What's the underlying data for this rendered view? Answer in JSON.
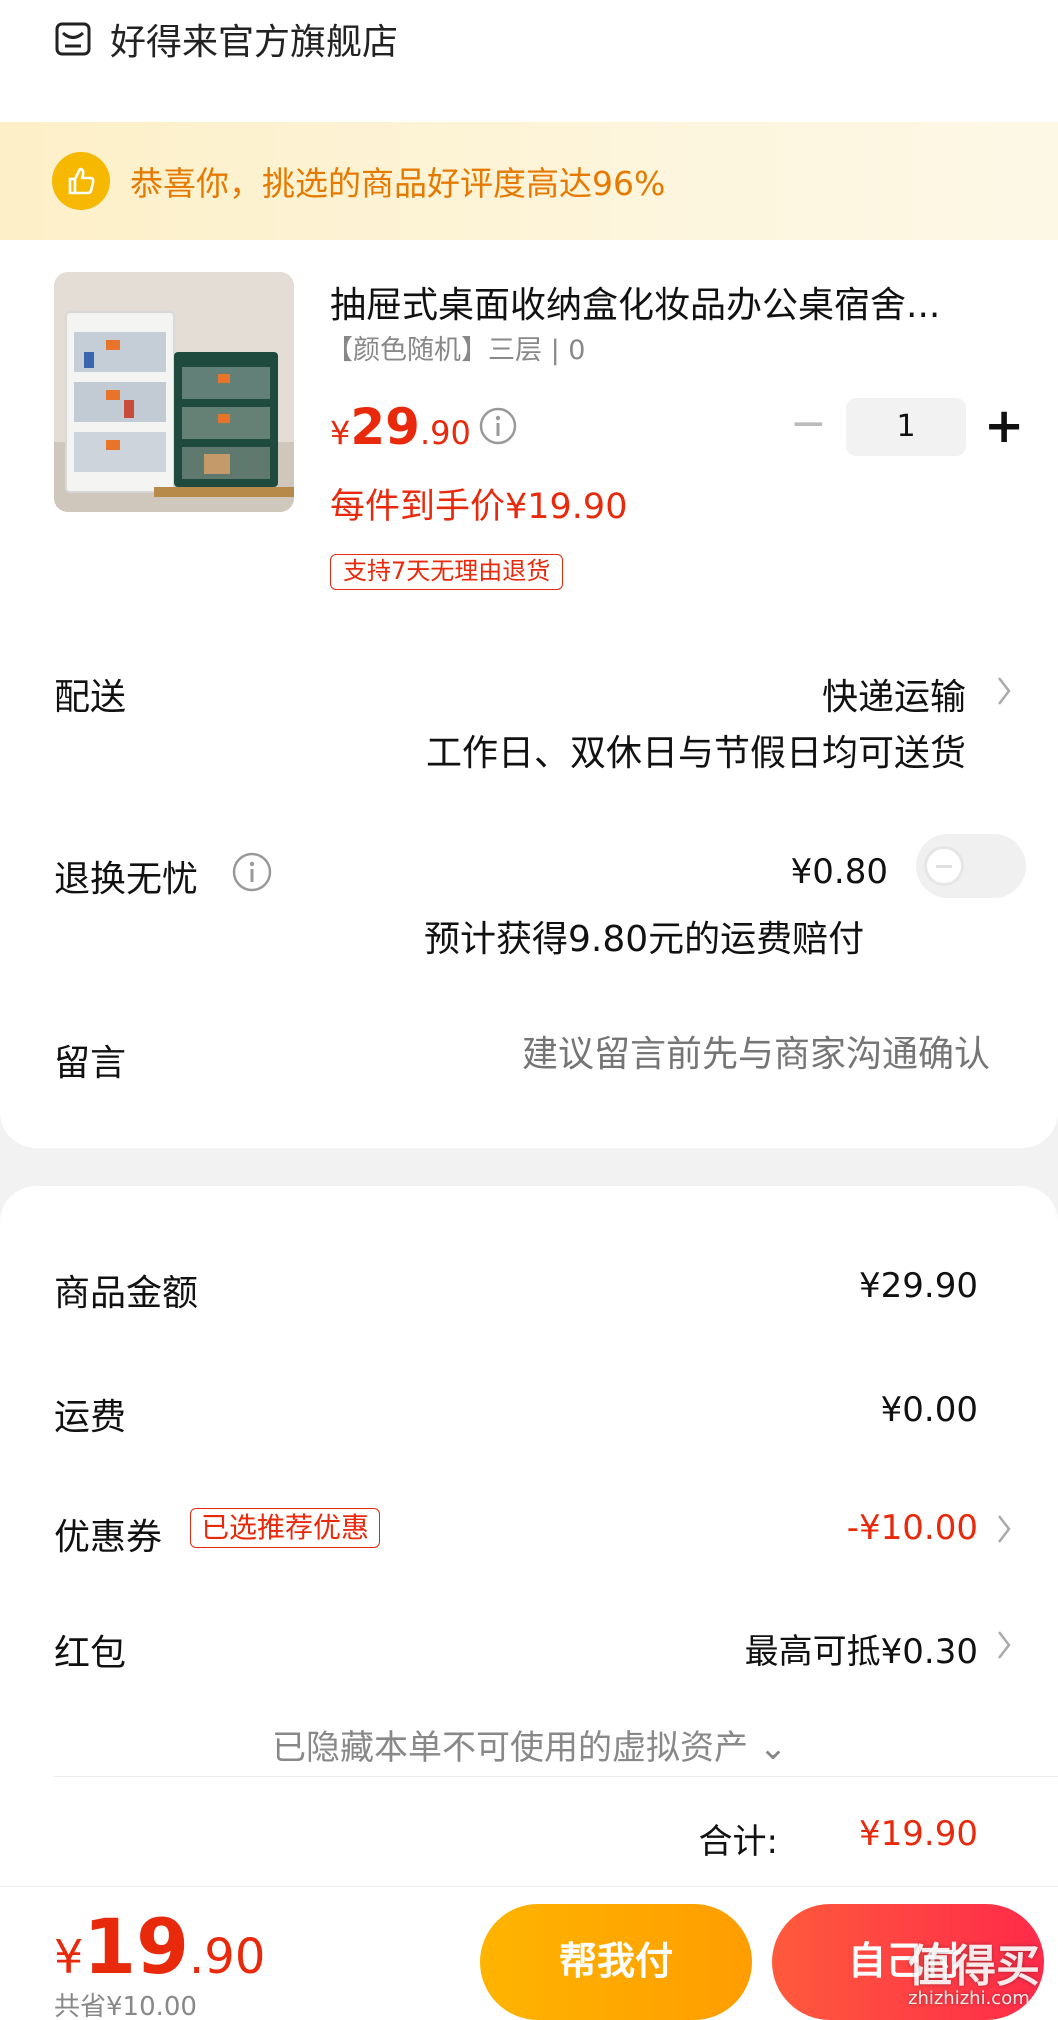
{
  "shop": {
    "name": "好得来官方旗舰店",
    "icon": "shop-icon"
  },
  "banner": {
    "text": "恭喜你，挑选的商品好评度高达96%",
    "icon": "thumbs-up-icon"
  },
  "product": {
    "title": "抽屉式桌面收纳盒化妆品办公桌宿舍...",
    "spec": "【颜色随机】三层 | 0",
    "price_symbol": "¥",
    "price_int": "29",
    "price_dec": ".90",
    "quantity": "1",
    "minus": "−",
    "plus": "+",
    "unit_price": "每件到手价¥19.90",
    "refund_tag": "支持7天无理由退货"
  },
  "delivery": {
    "label": "配送",
    "value": "快递运输",
    "note": "工作日、双休日与节假日均可送货"
  },
  "return_service": {
    "label": "退换无忧",
    "price": "¥0.80",
    "note": "预计获得9.80元的运费赔付",
    "enabled": false
  },
  "message": {
    "label": "留言",
    "placeholder": "建议留言前先与商家沟通确认"
  },
  "summary": {
    "goods_label": "商品金额",
    "goods_value": "¥29.90",
    "shipping_label": "运费",
    "shipping_value": "¥0.00",
    "coupon_label": "优惠券",
    "coupon_tag": "已选推荐优惠",
    "coupon_value": "-¥10.00",
    "redpacket_label": "红包",
    "redpacket_value": "最高可抵¥0.30",
    "hidden_assets": "已隐藏本单不可使用的虚拟资产 ⌄",
    "total_label": "合计:",
    "total_value": "¥19.90"
  },
  "bottom": {
    "price_symbol": "¥",
    "price_int": "19",
    "price_dec": ".90",
    "saved": "共省¥10.00",
    "help_pay": "帮我付",
    "self_pay": "自己付",
    "watermark": "值得买",
    "watermark_sub": "zhizhizhi.com"
  },
  "colors": {
    "accent_red": "#e8290b",
    "banner_text": "#e67a00",
    "help_button": "#ffb400",
    "pay_button": "#ff2a4a"
  }
}
